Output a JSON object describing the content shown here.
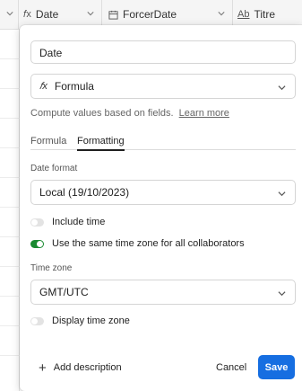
{
  "grid": {
    "columns": [
      {
        "icon": "fx-icon",
        "icon_glyph": "𝑓x",
        "label": "Date"
      },
      {
        "icon": "calendar-icon",
        "icon_glyph": "📅",
        "label": "ForcerDate"
      },
      {
        "icon": "text-field-icon",
        "icon_glyph": "A͟a",
        "label": "Titre"
      }
    ]
  },
  "panel": {
    "field_name": "Date",
    "field_type": {
      "icon_glyph": "𝑓x",
      "label": "Formula"
    },
    "help_text": "Compute values based on fields.",
    "help_link": "Learn more",
    "tabs": [
      {
        "label": "Formula",
        "active": false
      },
      {
        "label": "Formatting",
        "active": true
      }
    ],
    "date_format": {
      "label": "Date format",
      "value": "Local (19/10/2023)"
    },
    "include_time": {
      "label": "Include time",
      "on": false
    },
    "same_time_zone": {
      "label": "Use the same time zone for all collaborators",
      "on": true
    },
    "time_zone": {
      "label": "Time zone",
      "value": "GMT/UTC"
    },
    "display_time_zone": {
      "label": "Display time zone",
      "on": false
    },
    "footer": {
      "add_description": "Add description",
      "cancel": "Cancel",
      "save": "Save"
    }
  },
  "colors": {
    "accent": "#166ee1",
    "toggle_on": "#1a8a31",
    "toggle_off": "#e3e3e3"
  }
}
